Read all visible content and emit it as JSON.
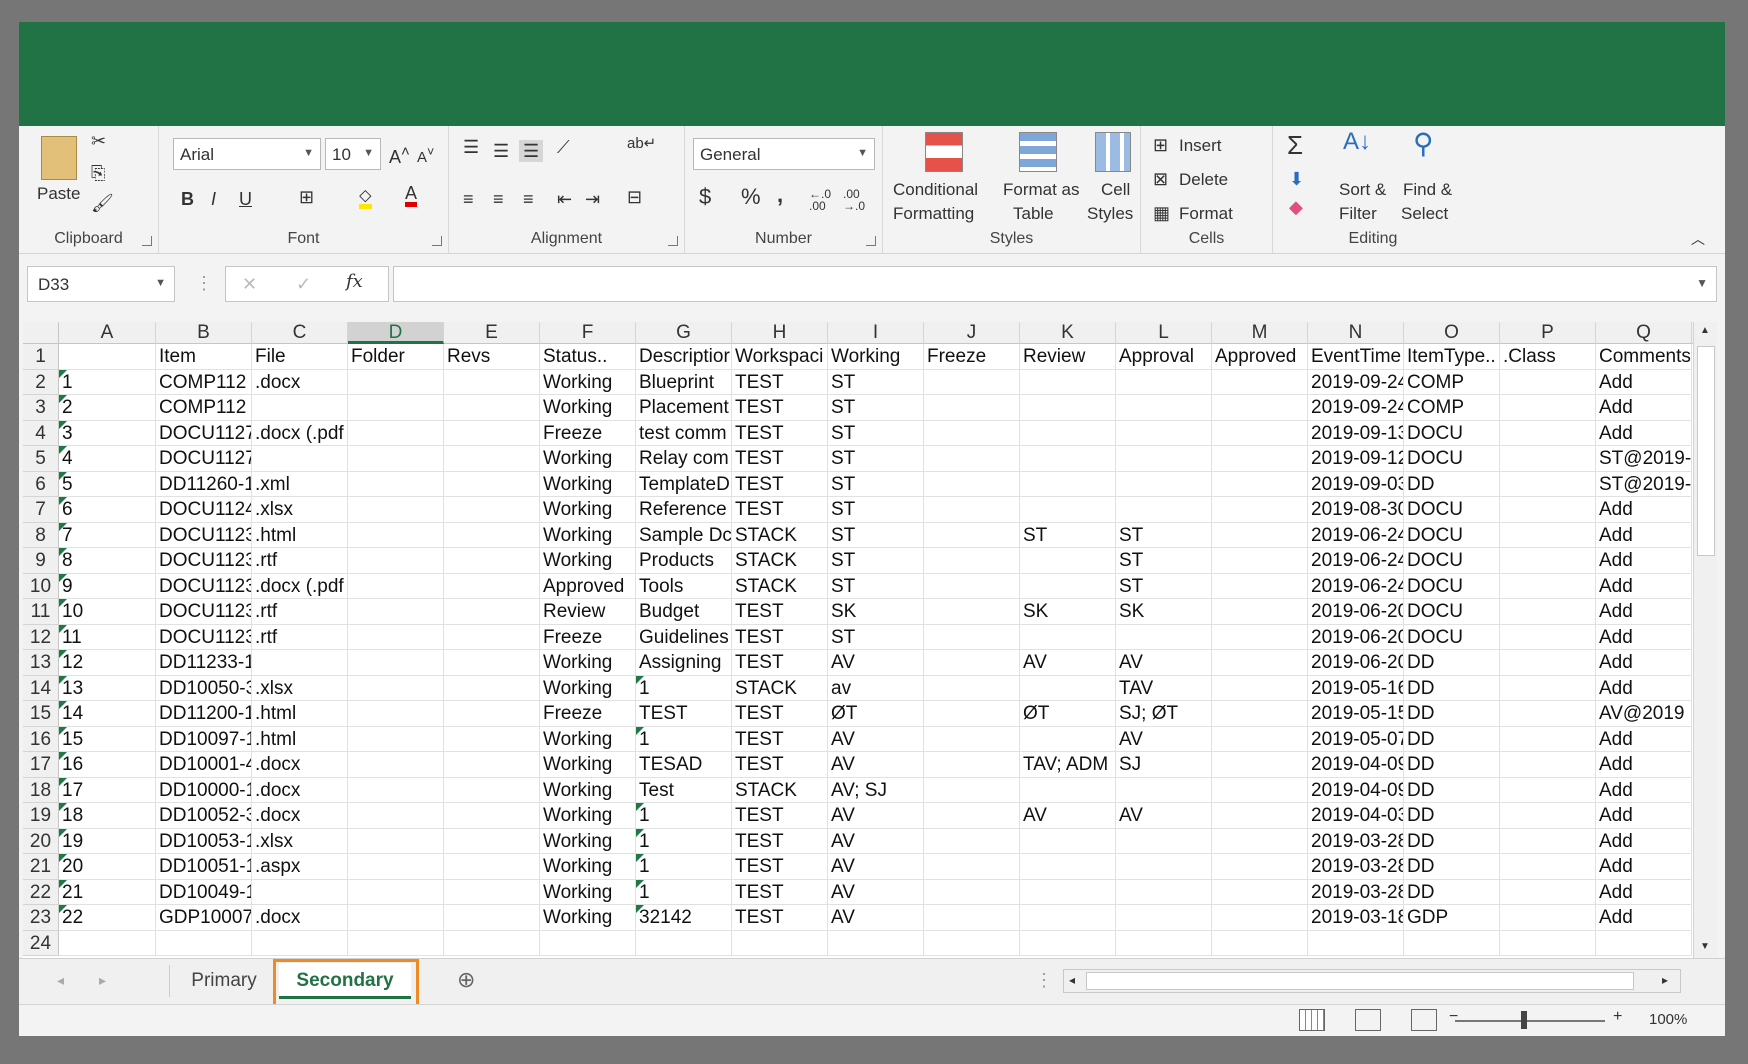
{
  "ribbon": {
    "clipboard": {
      "label": "Clipboard",
      "paste": "Paste"
    },
    "font": {
      "label": "Font",
      "name": "Arial",
      "size": "10",
      "bold": "B",
      "italic": "I",
      "underline": "U"
    },
    "alignment": {
      "label": "Alignment"
    },
    "number": {
      "label": "Number",
      "format": "General",
      "currency": "$",
      "percent": "%",
      "comma": ","
    },
    "styles": {
      "label": "Styles",
      "conditional1": "Conditional",
      "conditional2": "Formatting",
      "format_as1": "Format as",
      "format_as2": "Table",
      "cell_styles1": "Cell",
      "cell_styles2": "Styles"
    },
    "cells": {
      "label": "Cells",
      "insert": "Insert",
      "delete": "Delete",
      "format": "Format"
    },
    "editing": {
      "label": "Editing",
      "sort1": "Sort &",
      "sort2": "Filter",
      "find1": "Find &",
      "find2": "Select"
    }
  },
  "formula_bar": {
    "name_box": "D33",
    "fx": "fx",
    "value": ""
  },
  "columns": [
    "A",
    "B",
    "C",
    "D",
    "E",
    "F",
    "G",
    "H",
    "I",
    "J",
    "K",
    "L",
    "M",
    "N",
    "O",
    "P",
    "Q"
  ],
  "active_column": "D",
  "rows": [
    [
      "",
      "Item",
      "File",
      "Folder",
      "Revs",
      "Status..",
      "Descriptior",
      "Workspaci",
      "Working",
      "Freeze",
      "Review",
      "Approval",
      "Approved",
      "EventTime",
      "ItemType..",
      ".Class",
      "Comments"
    ],
    [
      "1",
      "COMP112",
      ".docx",
      "",
      "",
      "Working",
      "Blueprint",
      "TEST",
      "ST",
      "",
      "",
      "",
      "",
      "2019-09-24",
      "COMP",
      "",
      "Add"
    ],
    [
      "2",
      "COMP112",
      "",
      "",
      "",
      "Working",
      "Placement",
      "TEST",
      "ST",
      "",
      "",
      "",
      "",
      "2019-09-24",
      "COMP",
      "",
      "Add"
    ],
    [
      "3",
      "DOCU1127",
      ".docx (.pdf",
      "",
      "",
      "Freeze",
      "test comm",
      "TEST",
      "ST",
      "",
      "",
      "",
      "",
      "2019-09-13",
      "DOCU",
      "",
      "Add"
    ],
    [
      "4",
      "DOCU1127",
      "",
      "",
      "",
      "Working",
      "Relay com",
      "TEST",
      "ST",
      "",
      "",
      "",
      "",
      "2019-09-12",
      "DOCU",
      "",
      "ST@2019-"
    ],
    [
      "5",
      "DD11260-1",
      ".xml",
      "",
      "",
      "Working",
      "TemplateD",
      "TEST",
      "ST",
      "",
      "",
      "",
      "",
      "2019-09-03",
      "DD",
      "",
      "ST@2019-"
    ],
    [
      "6",
      "DOCU1124",
      ".xlsx",
      "",
      "",
      "Working",
      "Reference",
      "TEST",
      "ST",
      "",
      "",
      "",
      "",
      "2019-08-30",
      "DOCU",
      "",
      "Add"
    ],
    [
      "7",
      "DOCU1123",
      ".html",
      "",
      "",
      "Working",
      "Sample Dc",
      "STACK",
      "ST",
      "",
      "ST",
      "ST",
      "",
      "2019-06-24",
      "DOCU",
      "",
      "Add"
    ],
    [
      "8",
      "DOCU1123",
      ".rtf",
      "",
      "",
      "Working",
      "Products",
      "STACK",
      "ST",
      "",
      "",
      "ST",
      "",
      "2019-06-24",
      "DOCU",
      "",
      "Add"
    ],
    [
      "9",
      "DOCU1123",
      ".docx (.pdf",
      "",
      "",
      "Approved",
      "Tools",
      "STACK",
      "ST",
      "",
      "",
      "ST",
      "",
      "2019-06-24",
      "DOCU",
      "",
      "Add"
    ],
    [
      "10",
      "DOCU1123",
      ".rtf",
      "",
      "",
      "Review",
      "Budget",
      "TEST",
      "SK",
      "",
      "SK",
      "SK",
      "",
      "2019-06-20",
      "DOCU",
      "",
      "Add"
    ],
    [
      "11",
      "DOCU1123",
      ".rtf",
      "",
      "",
      "Freeze",
      "Guidelines",
      "TEST",
      "ST",
      "",
      "",
      "",
      "",
      "2019-06-20",
      "DOCU",
      "",
      "Add"
    ],
    [
      "12",
      "DD11233-1",
      "",
      "",
      "",
      "Working",
      "Assigning",
      "TEST",
      "AV",
      "",
      "AV",
      "AV",
      "",
      "2019-06-20",
      "DD",
      "",
      "Add"
    ],
    [
      "13",
      "DD10050-3",
      ".xlsx",
      "",
      "",
      "Working",
      "1",
      "STACK",
      "av",
      "",
      "",
      "TAV",
      "",
      "2019-05-16",
      "DD",
      "",
      "Add"
    ],
    [
      "14",
      "DD11200-1",
      ".html",
      "",
      "",
      "Freeze",
      "TEST",
      "TEST",
      "ØT",
      "",
      "ØT",
      "SJ; ØT",
      "",
      "2019-05-15",
      "DD",
      "",
      "AV@2019"
    ],
    [
      "15",
      "DD10097-1",
      ".html",
      "",
      "",
      "Working",
      "1",
      "TEST",
      "AV",
      "",
      "",
      "AV",
      "",
      "2019-05-07",
      "DD",
      "",
      "Add"
    ],
    [
      "16",
      "DD10001-4",
      ".docx",
      "",
      "",
      "Working",
      "TESAD",
      "TEST",
      "AV",
      "",
      "TAV; ADM",
      "SJ",
      "",
      "2019-04-09",
      "DD",
      "",
      "Add"
    ],
    [
      "17",
      "DD10000-1",
      ".docx",
      "",
      "",
      "Working",
      "Test",
      "STACK",
      "AV; SJ",
      "",
      "",
      "",
      "",
      "2019-04-09",
      "DD",
      "",
      "Add"
    ],
    [
      "18",
      "DD10052-3",
      ".docx",
      "",
      "",
      "Working",
      "1",
      "TEST",
      "AV",
      "",
      "AV",
      "AV",
      "",
      "2019-04-03",
      "DD",
      "",
      "Add"
    ],
    [
      "19",
      "DD10053-1",
      ".xlsx",
      "",
      "",
      "Working",
      "1",
      "TEST",
      "AV",
      "",
      "",
      "",
      "",
      "2019-03-28",
      "DD",
      "",
      "Add"
    ],
    [
      "20",
      "DD10051-1",
      ".aspx",
      "",
      "",
      "Working",
      "1",
      "TEST",
      "AV",
      "",
      "",
      "",
      "",
      "2019-03-28",
      "DD",
      "",
      "Add"
    ],
    [
      "21",
      "DD10049-1",
      "",
      "",
      "",
      "Working",
      "1",
      "TEST",
      "AV",
      "",
      "",
      "",
      "",
      "2019-03-28",
      "DD",
      "",
      "Add"
    ],
    [
      "22",
      "GDP10007",
      ".docx",
      "",
      "",
      "Working",
      "32142",
      "TEST",
      "AV",
      "",
      "",
      "",
      "",
      "2019-03-18",
      "GDP",
      "",
      "Add"
    ],
    [
      "",
      "",
      "",
      "",
      "",
      "",
      "",
      "",
      "",
      "",
      "",
      "",
      "",
      "",
      "",
      "",
      ""
    ]
  ],
  "sheets": {
    "primary": "Primary",
    "secondary": "Secondary",
    "active": "Secondary"
  },
  "status": {
    "zoom": "100%"
  },
  "colors": {
    "accent": "#217346",
    "highlight": "#f08a24"
  }
}
